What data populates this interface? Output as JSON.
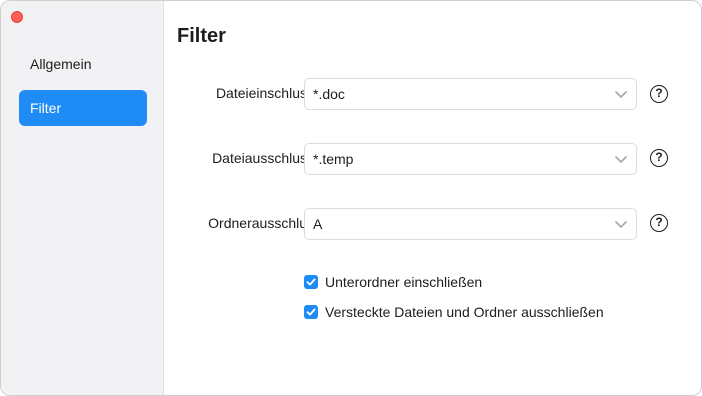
{
  "window": {
    "close_color": "#ff5f57",
    "accent_color": "#1f8bf5"
  },
  "sidebar": {
    "items": [
      {
        "label": "Allgemein",
        "active": false
      },
      {
        "label": "Filter",
        "active": true
      }
    ]
  },
  "main": {
    "title": "Filter",
    "rows": [
      {
        "label": "Dateieinschluss",
        "value": "*.doc",
        "help_icon": "question-circle-icon"
      },
      {
        "label": "Dateiausschluss",
        "value": "*.temp",
        "help_icon": "question-circle-icon"
      },
      {
        "label": "Ordnerausschlus",
        "value": "A",
        "help_icon": "question-circle-icon"
      }
    ],
    "help_glyph": "?",
    "checkboxes": [
      {
        "label": "Unterordner einschließen",
        "checked": true
      },
      {
        "label": "Versteckte Dateien und Ordner ausschließen",
        "checked": true
      }
    ]
  }
}
